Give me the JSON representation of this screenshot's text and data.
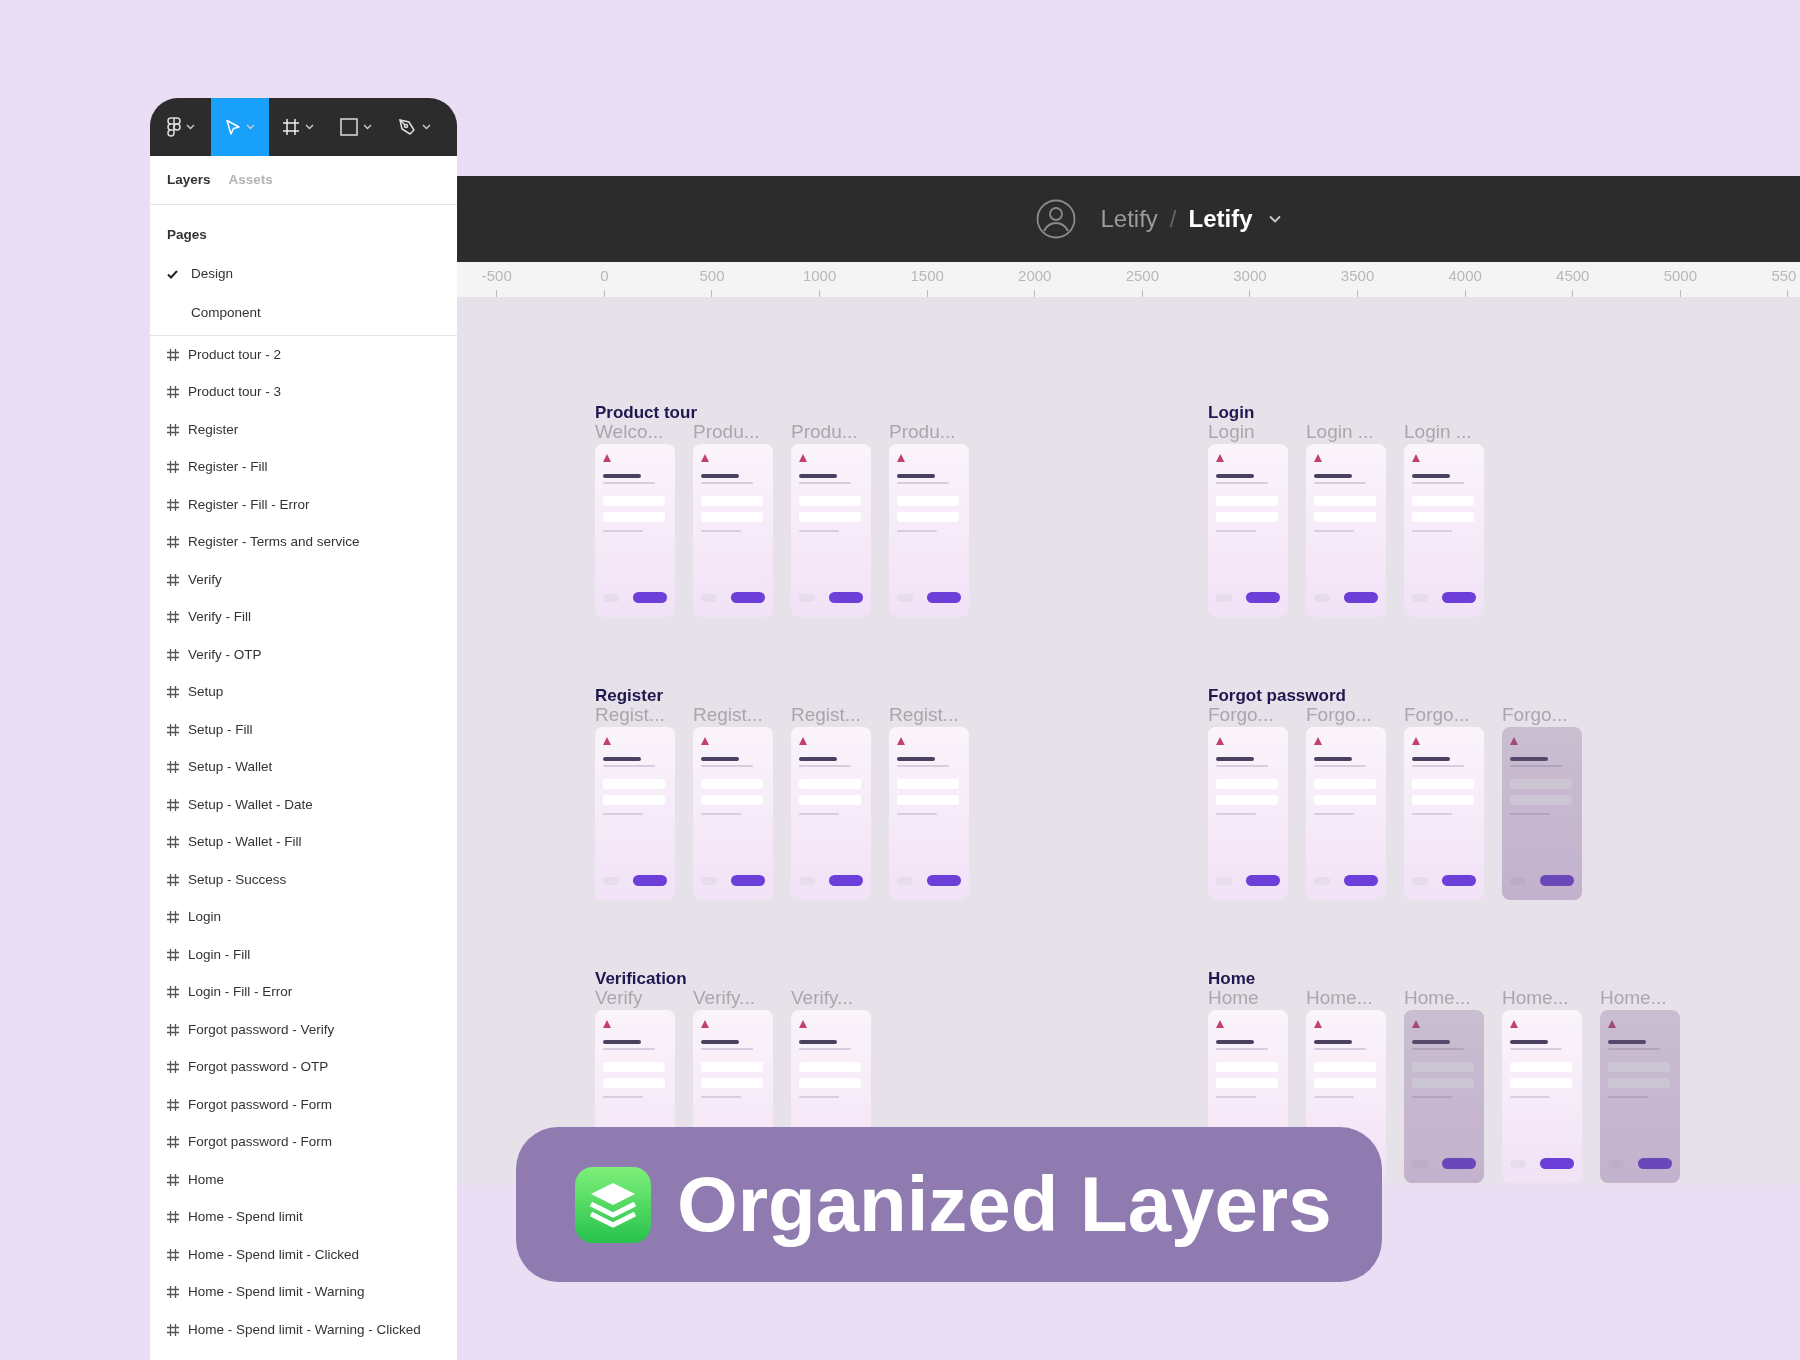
{
  "toolbar": {
    "tools": [
      {
        "kind": "logo",
        "selected": false
      },
      {
        "kind": "move",
        "selected": true
      },
      {
        "kind": "frame",
        "selected": false
      },
      {
        "kind": "shape",
        "selected": false
      },
      {
        "kind": "pen",
        "selected": false
      }
    ]
  },
  "panel_tabs": [
    {
      "label": "Layers",
      "selected": true
    },
    {
      "label": "Assets",
      "selected": false
    }
  ],
  "pages": {
    "heading": "Pages",
    "items": [
      {
        "label": "Design",
        "selected": true
      },
      {
        "label": "Component",
        "selected": false
      }
    ]
  },
  "layers": [
    "Product tour - 2",
    "Product tour - 3",
    "Register",
    "Register - Fill",
    "Register - Fill - Error",
    "Register - Terms and service",
    "Verify",
    "Verify - Fill",
    "Verify - OTP",
    "Setup",
    "Setup - Fill",
    "Setup - Wallet",
    "Setup - Wallet -  Date",
    "Setup - Wallet - Fill",
    "Setup - Success",
    "Login",
    "Login - Fill",
    "Login - Fill - Error",
    "Forgot password - Verify",
    "Forgot password - OTP",
    "Forgot password - Form",
    "Forgot password - Form",
    "Home",
    "Home - Spend limit",
    "Home - Spend limit - Clicked",
    "Home - Spend limit - Warning",
    "Home - Spend limit - Warning - Clicked"
  ],
  "file_header": {
    "team": "Letify",
    "separator": "/",
    "file": "Letify"
  },
  "ruler": [
    "-500",
    "0",
    "500",
    "1000",
    "1500",
    "2000",
    "2500",
    "3000",
    "3500",
    "4000",
    "4500",
    "5000",
    "550"
  ],
  "sections": [
    {
      "title": "Product tour",
      "frames": [
        {
          "label": "Welco...",
          "overlay": false
        },
        {
          "label": "Produ...",
          "overlay": false
        },
        {
          "label": "Produ...",
          "overlay": false
        },
        {
          "label": "Produ...",
          "overlay": false
        }
      ]
    },
    {
      "title": "Login",
      "frames": [
        {
          "label": "Login",
          "overlay": false
        },
        {
          "label": "Login ...",
          "overlay": false
        },
        {
          "label": "Login ...",
          "overlay": false
        }
      ]
    },
    {
      "title": "Register",
      "frames": [
        {
          "label": "Regist...",
          "overlay": false
        },
        {
          "label": "Regist...",
          "overlay": false
        },
        {
          "label": "Regist...",
          "overlay": false
        },
        {
          "label": "Regist...",
          "overlay": false
        }
      ]
    },
    {
      "title": "Forgot password",
      "frames": [
        {
          "label": "Forgo...",
          "overlay": false
        },
        {
          "label": "Forgo...",
          "overlay": false
        },
        {
          "label": "Forgo...",
          "overlay": false
        },
        {
          "label": "Forgo...",
          "overlay": true
        }
      ]
    },
    {
      "title": "Verification",
      "frames": [
        {
          "label": "Verify",
          "overlay": false
        },
        {
          "label": "Verify...",
          "overlay": false
        },
        {
          "label": "Verify...",
          "overlay": false
        }
      ]
    },
    {
      "title": "Home",
      "frames": [
        {
          "label": "Home",
          "overlay": false
        },
        {
          "label": "Home...",
          "overlay": false
        },
        {
          "label": "Home...",
          "overlay": true
        },
        {
          "label": "Home...",
          "overlay": false
        },
        {
          "label": "Home...",
          "overlay": true
        }
      ]
    }
  ],
  "banner": {
    "text": "Organized Layers"
  }
}
